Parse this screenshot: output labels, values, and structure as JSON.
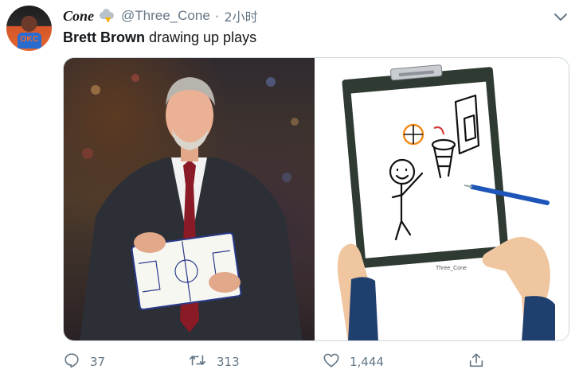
{
  "tweet": {
    "display_name": "Cone",
    "name_emoji": "cloud-lightning-icon",
    "handle": "@Three_Cone",
    "separator": "·",
    "time": "2小时",
    "text_bold": "Brett Brown",
    "text_rest": " drawing up plays",
    "avatar_jersey": "OKC"
  },
  "media": {
    "left_photo": "coach-holding-clipboard",
    "right_photo": "hand-drawn-clipboard-stickman",
    "right_watermark": "Three_Cone"
  },
  "actions": {
    "reply_count": "37",
    "retweet_count": "313",
    "like_count": "1,444"
  },
  "colors": {
    "text_primary": "#14171a",
    "text_secondary": "#657786",
    "border": "#ccd6dd"
  }
}
